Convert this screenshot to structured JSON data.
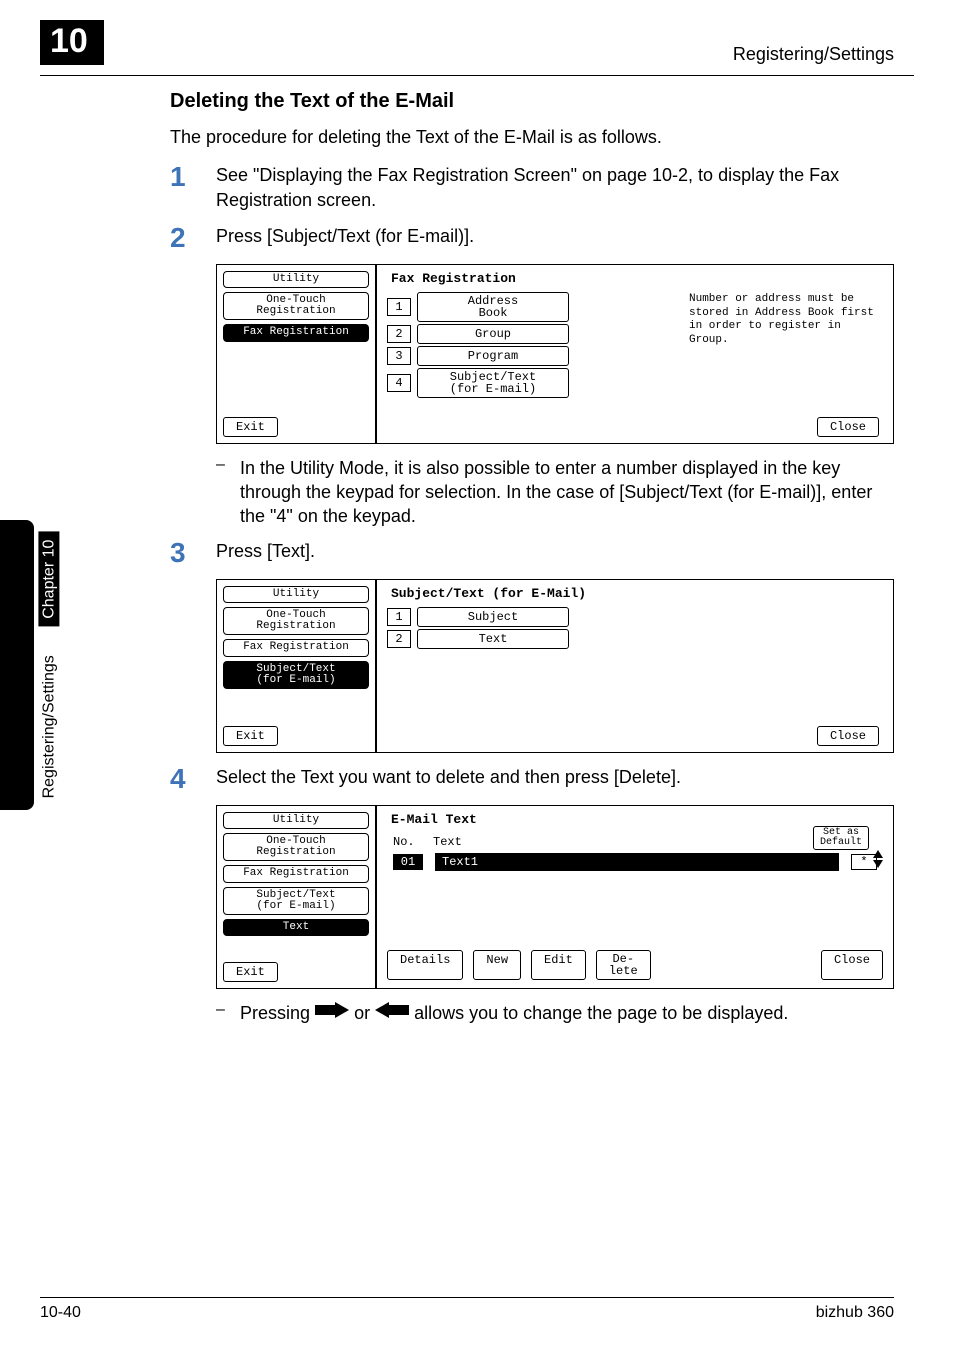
{
  "header": {
    "chapter_number": "10",
    "section_title": "Registering/Settings"
  },
  "sidebar": {
    "label": "Registering/Settings",
    "chapter": "Chapter 10"
  },
  "title": "Deleting the Text of the E-Mail",
  "intro": "The procedure for deleting the Text of the E-Mail is as follows.",
  "steps": {
    "s1": "See \"Displaying the Fax Registration Screen\" on page 10-2, to display the Fax Registration screen.",
    "s2": "Press [Subject/Text (for E-mail)].",
    "s2_note": "In the Utility Mode, it is also possible to enter a number displayed in the key through the keypad for selection. In the case of [Subject/Text (for E-mail)], enter the \"4\" on the keypad.",
    "s3": "Press [Text].",
    "s4": "Select the Text you want to delete and then press [Delete].",
    "s4_note_before": "Pressing",
    "s4_note_mid": "or",
    "s4_note_after": "allows you to change the page to be displayed."
  },
  "device1": {
    "title": "Fax Registration",
    "side": {
      "utility": "Utility",
      "onetouch": "One-Touch\nRegistration",
      "faxreg": "Fax Registration",
      "exit": "Exit"
    },
    "menu": {
      "i1": {
        "n": "1",
        "l": "Address\nBook"
      },
      "i2": {
        "n": "2",
        "l": "Group"
      },
      "i3": {
        "n": "3",
        "l": "Program"
      },
      "i4": {
        "n": "4",
        "l": "Subject/Text\n(for E-mail)"
      }
    },
    "hint": "Number or address must be stored in Address Book first in order to register in Group.",
    "close": "Close"
  },
  "device2": {
    "title": "Subject/Text (for E-Mail)",
    "side": {
      "utility": "Utility",
      "onetouch": "One-Touch\nRegistration",
      "faxreg": "Fax Registration",
      "subj": "Subject/Text\n(for E-mail)",
      "exit": "Exit"
    },
    "menu": {
      "i1": {
        "n": "1",
        "l": "Subject"
      },
      "i2": {
        "n": "2",
        "l": "Text"
      }
    },
    "close": "Close"
  },
  "device3": {
    "title": "E-Mail Text",
    "side": {
      "utility": "Utility",
      "onetouch": "One-Touch\nRegistration",
      "faxreg": "Fax Registration",
      "subj": "Subject/Text\n(for E-mail)",
      "text": "Text",
      "exit": "Exit"
    },
    "table": {
      "h_no": "No.",
      "h_text": "Text",
      "set_as": "Set as\nDefault",
      "row_no": "01",
      "row_text": "Text1",
      "row_star": "*"
    },
    "buttons": {
      "details": "Details",
      "new": "New",
      "edit": "Edit",
      "delete": "De-\nlete",
      "close": "Close"
    }
  },
  "footer": {
    "page": "10-40",
    "product": "bizhub 360"
  }
}
